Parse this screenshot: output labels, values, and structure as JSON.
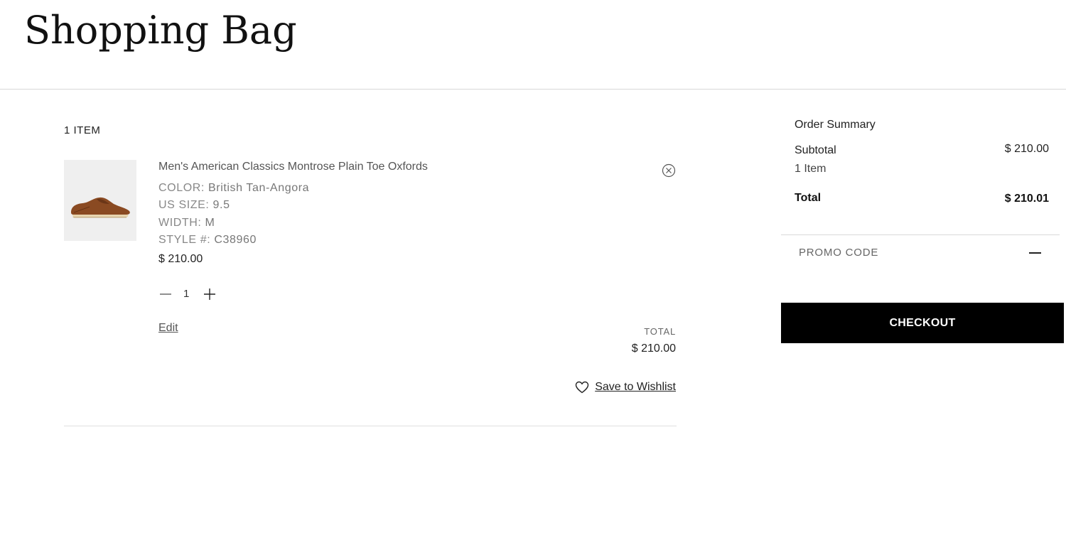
{
  "page": {
    "title": "Shopping Bag"
  },
  "cart": {
    "item_count_label": "1 ITEM",
    "items": [
      {
        "name": "Men's American Classics Montrose Plain Toe Oxfords",
        "color_label": "COLOR:",
        "color_value": "British Tan-Angora",
        "size_label": "US SIZE:",
        "size_value": "9.5",
        "width_label": "WIDTH:",
        "width_value": "M",
        "style_label": "STYLE #:",
        "style_value": "C38960",
        "unit_price": "$ 210.00",
        "quantity": "1",
        "edit_label": "Edit",
        "total_label": "TOTAL",
        "total_value": "$ 210.00",
        "wishlist_label": "Save to Wishlist",
        "image_icon": "oxford-shoe-image"
      }
    ]
  },
  "summary": {
    "title": "Order Summary",
    "subtotal_label": "Subtotal",
    "subtotal_value": "$ 210.00",
    "items_label": "1 Item",
    "total_label": "Total",
    "total_value": "$ 210.01",
    "promo_label": "PROMO CODE",
    "checkout_label": "CHECKOUT"
  },
  "colors": {
    "checkout_bg": "#000000",
    "checkout_text": "#ffffff",
    "thumb_bg": "#efefef"
  },
  "icons": {
    "remove": "circle-x-icon",
    "qty_decrease": "minus-icon",
    "qty_increase": "plus-icon",
    "wishlist": "heart-icon",
    "promo_toggle": "minus-icon"
  }
}
